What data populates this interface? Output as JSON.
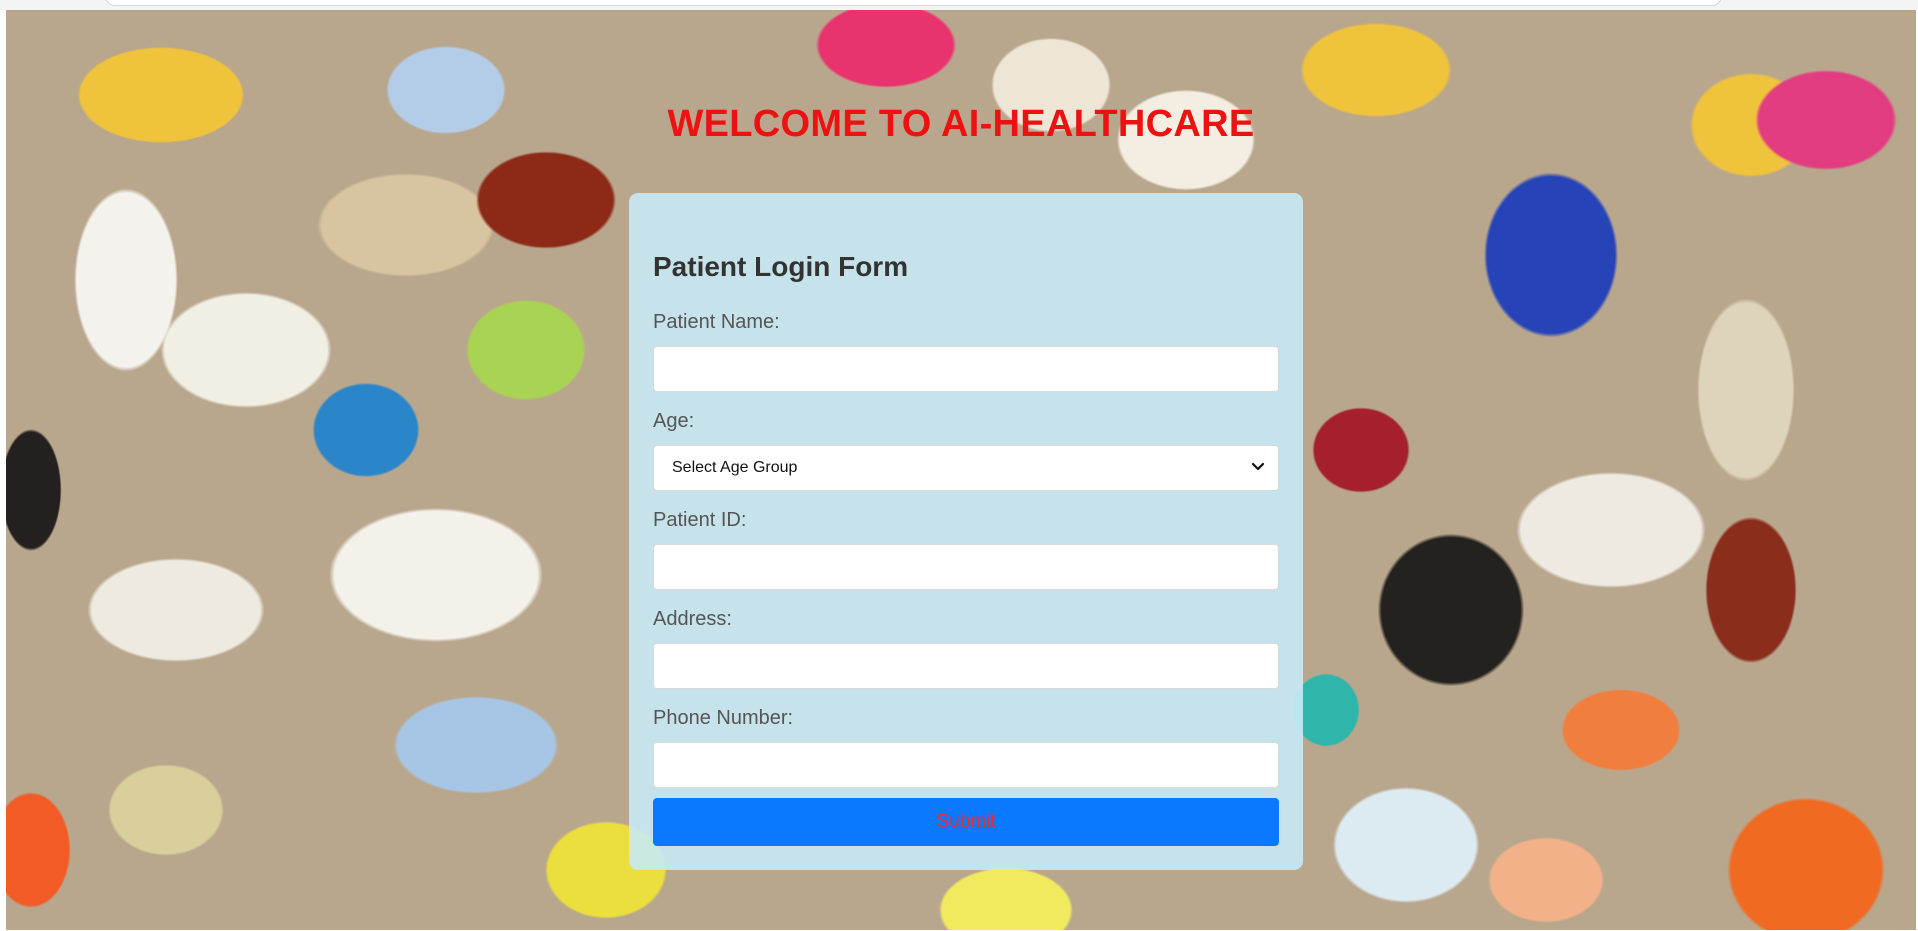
{
  "page": {
    "heading": "WELCOME TO AI-HEALTHCARE",
    "background_image": "assorted-pills-photo"
  },
  "form": {
    "title": "Patient Login Form",
    "fields": {
      "patient_name": {
        "label": "Patient Name:",
        "value": ""
      },
      "age": {
        "label": "Age:",
        "selected": "Select Age Group"
      },
      "patient_id": {
        "label": "Patient ID:",
        "value": ""
      },
      "address": {
        "label": "Address:",
        "value": ""
      },
      "phone_number": {
        "label": "Phone Number:",
        "value": ""
      }
    },
    "submit_label": "Submit"
  },
  "colors": {
    "heading": "#ee1111",
    "card_background": "#c8eaf5",
    "button_background": "#0b79ff",
    "button_text": "#ee2a2a"
  },
  "icons": {
    "select_arrow": "chevron-down-icon"
  }
}
